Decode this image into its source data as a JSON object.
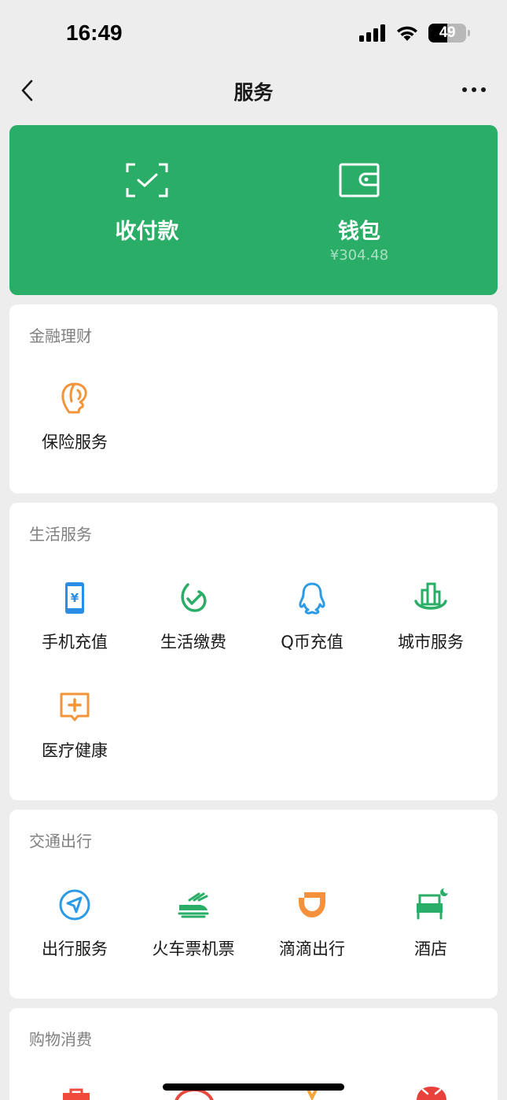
{
  "status": {
    "time": "16:49",
    "battery": "49",
    "battery_level": 0.49
  },
  "nav": {
    "title": "服务"
  },
  "hero": {
    "pay": {
      "label": "收付款"
    },
    "wallet": {
      "label": "钱包",
      "balance": "¥304.48"
    },
    "bg_color": "#2aae67"
  },
  "sections": [
    {
      "title": "金融理财",
      "items": [
        {
          "label": "保险服务",
          "icon": "insurance-icon"
        }
      ]
    },
    {
      "title": "生活服务",
      "items": [
        {
          "label": "手机充值",
          "icon": "phone-recharge-icon"
        },
        {
          "label": "生活缴费",
          "icon": "utility-payment-icon"
        },
        {
          "label": "Q币充值",
          "icon": "qq-coin-icon"
        },
        {
          "label": "城市服务",
          "icon": "city-service-icon"
        },
        {
          "label": "医疗健康",
          "icon": "medical-icon"
        }
      ]
    },
    {
      "title": "交通出行",
      "items": [
        {
          "label": "出行服务",
          "icon": "navigation-icon"
        },
        {
          "label": "火车票机票",
          "icon": "train-ticket-icon"
        },
        {
          "label": "滴滴出行",
          "icon": "didi-icon"
        },
        {
          "label": "酒店",
          "icon": "hotel-icon"
        }
      ]
    },
    {
      "title": "购物消费",
      "items": []
    }
  ]
}
